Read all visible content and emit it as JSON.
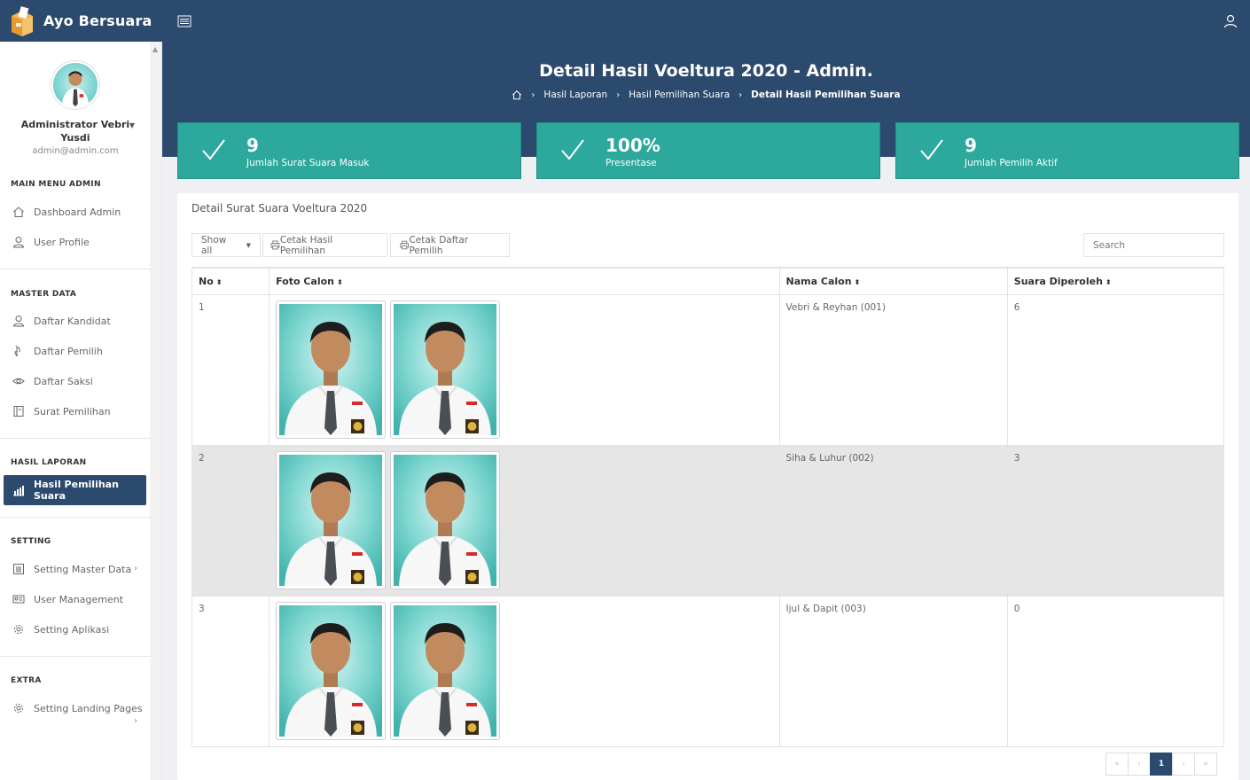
{
  "app": {
    "title": "Ayo Bersuara"
  },
  "profile": {
    "name": "Administrator Vebri Yusdi",
    "email": "admin@admin.com"
  },
  "sidebar": {
    "sections": [
      {
        "title": "MAIN MENU ADMIN",
        "items": [
          {
            "label": "Dashboard Admin",
            "icon": "home-icon"
          },
          {
            "label": "User Profile",
            "icon": "user-icon"
          }
        ]
      },
      {
        "title": "MASTER DATA",
        "items": [
          {
            "label": "Daftar Kandidat",
            "icon": "user-icon"
          },
          {
            "label": "Daftar Pemilih",
            "icon": "hand-icon"
          },
          {
            "label": "Daftar Saksi",
            "icon": "eye-icon"
          },
          {
            "label": "Surat Pemilihan",
            "icon": "document-icon"
          }
        ]
      },
      {
        "title": "HASIL LAPORAN",
        "items": [
          {
            "label": "Hasil Pemilihan Suara",
            "icon": "bar-chart-icon",
            "active": true
          }
        ]
      },
      {
        "title": "SETTING",
        "items": [
          {
            "label": "Setting Master Data",
            "icon": "grid-icon"
          },
          {
            "label": "User Management",
            "icon": "id-card-icon"
          },
          {
            "label": "Setting Aplikasi",
            "icon": "gear-icon"
          }
        ]
      },
      {
        "title": "EXTRA",
        "items": [
          {
            "label": "Setting Landing Pages",
            "icon": "gear-icon"
          }
        ]
      }
    ]
  },
  "header": {
    "title": "Detail Hasil Voeltura 2020 - Admin.",
    "breadcrumb": [
      "Hasil Laporan",
      "Hasil Pemilihan Suara",
      "Detail Hasil Pemilihan Suara"
    ]
  },
  "stats": [
    {
      "value": "9",
      "label": "Jumlah Surat Suara Masuk"
    },
    {
      "value": "100%",
      "label": "Presentase"
    },
    {
      "value": "9",
      "label": "Jumlah Pemilih Aktif"
    }
  ],
  "card": {
    "title": "Detail Surat Suara Voeltura 2020",
    "show_all": "Show all",
    "btn_print_results": "Cetak Hasil Pemilihan",
    "btn_print_voters": "Cetak Daftar Pemilih",
    "search_placeholder": "Search"
  },
  "table": {
    "columns": [
      "No",
      "Foto Calon",
      "Nama Calon",
      "Suara Diperoleh"
    ],
    "rows": [
      {
        "no": "1",
        "name": "Vebri & Reyhan (001)",
        "votes": "6"
      },
      {
        "no": "2",
        "name": "Siha & Luhur (002)",
        "votes": "3"
      },
      {
        "no": "3",
        "name": "Ijul & Dapit (003)",
        "votes": "0"
      }
    ]
  },
  "pagination": {
    "first": "«",
    "prev": "‹",
    "current": "1",
    "next": "›",
    "last": "»"
  },
  "colors": {
    "navy": "#2b4a6e",
    "teal": "#2ca89d",
    "row_shade": "#e6e6e6"
  }
}
